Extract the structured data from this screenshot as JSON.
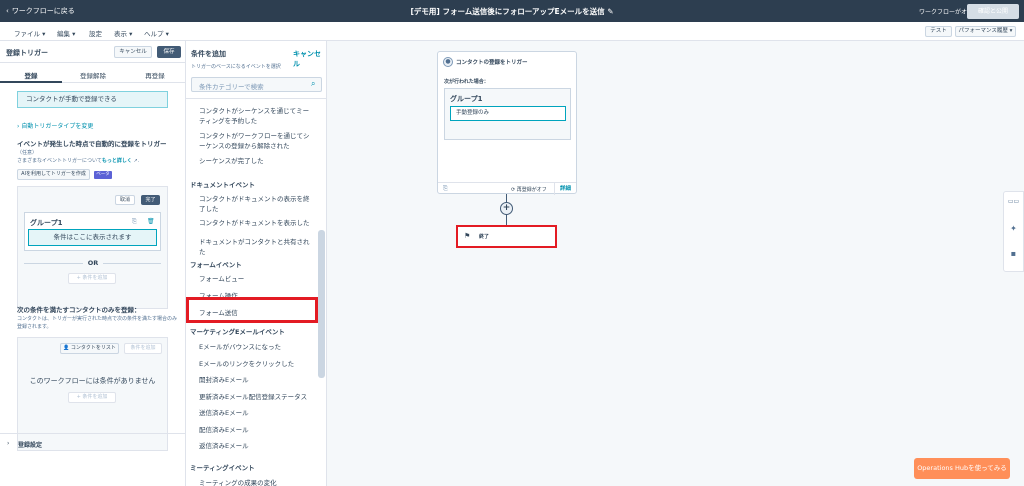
{
  "topbar": {
    "back_label": "ワークフローに戻る",
    "title": "[デモ用] フォーム送信後にフォローアップEメールを送信",
    "workflow_status": "ワークフローがオフ",
    "publish_label": "確認と公開"
  },
  "menu": {
    "file": "ファイル",
    "edit": "編集",
    "settings": "設定",
    "view": "表示",
    "help": "ヘルプ",
    "test": "テスト",
    "performance": "パフォーマンス履歴"
  },
  "left": {
    "title": "登録トリガー",
    "cancel": "キャンセル",
    "save": "保存",
    "tabs": [
      "登録",
      "登録解除",
      "再登録"
    ],
    "manual_info": "コンタクトが手動で登録できる",
    "change_type": "自動トリガータイプを変更",
    "event_heading": "イベントが発生した時点で自動的に登録をトリガー",
    "optional": "（任意）",
    "event_desc": "さまざまなイベントトリガーについて",
    "learn_more": "もっと詳しく",
    "ai_button": "AIを利用してトリガーを作成",
    "beta": "ベータ",
    "cancel_small": "取消",
    "done_small": "完了",
    "group_label": "グループ1",
    "condition_placeholder": "条件はここに表示されます",
    "or_label": "OR",
    "add_condition": "+ 条件を追加",
    "cond_heading": "次の条件を満たすコンタクトのみを登録：",
    "cond_desc_1": "コンタクトは、トリガーが実行された時点で次の条件を満たす場合のみ",
    "cond_desc_2": "登録されます。",
    "contact_list_btn": "コンタクトをリスト",
    "add_condition_small": "条件を追加",
    "no_conditions": "このワークフローには条件がありません",
    "add_condition2": "+ 条件を追加",
    "registration_settings": "登録設定"
  },
  "middle": {
    "title": "条件を追加",
    "cancel": "キャンセル",
    "subtitle": "トリガーのベースになるイベントを選択",
    "search_placeholder": "条件カテゴリーで検索",
    "items": [
      {
        "type": "item",
        "text": "コンタクトがシーケンスを通じてミーティングを予約した"
      },
      {
        "type": "item",
        "text": "コンタクトがワークフローを通じてシーケンスの登録から解除された"
      },
      {
        "type": "item",
        "text": "シーケンスが完了した"
      },
      {
        "type": "cat",
        "text": "ドキュメントイベント"
      },
      {
        "type": "item",
        "text": "コンタクトがドキュメントの表示を終了した"
      },
      {
        "type": "item",
        "text": "コンタクトがドキュメントを表示した"
      },
      {
        "type": "item",
        "text": "ドキュメントがコンタクトと共有された"
      },
      {
        "type": "cat",
        "text": "フォームイベント"
      },
      {
        "type": "item",
        "text": "フォームビュー"
      },
      {
        "type": "item",
        "text": "フォーム操作"
      },
      {
        "type": "item",
        "text": "フォーム送信"
      },
      {
        "type": "cat",
        "text": "マーケティングEメールイベント"
      },
      {
        "type": "item",
        "text": "Eメールがバウンスになった"
      },
      {
        "type": "item",
        "text": "Eメールのリンクをクリックした"
      },
      {
        "type": "item",
        "text": "開封済みEメール"
      },
      {
        "type": "item",
        "text": "更新済みEメール配信登録ステータス"
      },
      {
        "type": "item",
        "text": "送信済みEメール"
      },
      {
        "type": "item",
        "text": "配信済みEメール"
      },
      {
        "type": "item",
        "text": "返信済みEメール"
      },
      {
        "type": "cat",
        "text": "ミーティングイベント"
      },
      {
        "type": "item",
        "text": "ミーティングの成果の変化"
      }
    ]
  },
  "canvas": {
    "trigger_title": "コンタクトの登録をトリガー",
    "when_label": "次が行われた場合：",
    "group_label": "グループ1",
    "condition": "手動登録のみ",
    "reenroll": "再登録がオフ",
    "details": "詳細",
    "end_label": "終了",
    "hub_button": "Operations Hubを使ってみる"
  }
}
